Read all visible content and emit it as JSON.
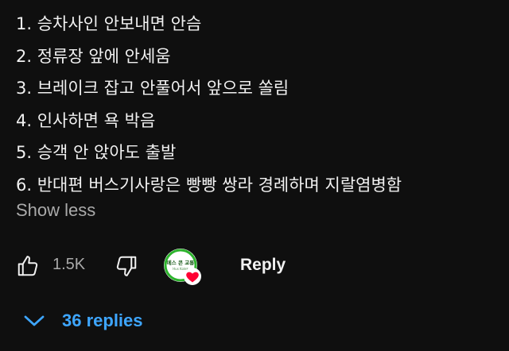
{
  "comment": {
    "lines": [
      "1. 승차사인 안보내면 안슴",
      "2. 정류장 앞에 안세움",
      "3. 브레이크 잡고 안풀어서 앞으로 쏠림",
      "4. 인사하면 욕 박음",
      "5. 승객 안 앉아도 출발",
      "6. 반대편 버스기사랑은 빵빵 쌍라 경례하며 지랄염병함"
    ],
    "show_less_label": "Show less"
  },
  "actions": {
    "like_count": "1.5K",
    "reply_label": "Reply",
    "creator_heart": {
      "avatar_text": "메스 콘 교통",
      "avatar_subtext": "Hus Kolek",
      "ring_color": "#2db32d",
      "heart_color": "#ff0033"
    }
  },
  "replies": {
    "label": "36 replies",
    "color": "#3ea6ff"
  },
  "icons": {
    "like": "thumbs-up-icon",
    "dislike": "thumbs-down-icon",
    "expand": "chevron-down-icon",
    "heart": "heart-icon"
  }
}
